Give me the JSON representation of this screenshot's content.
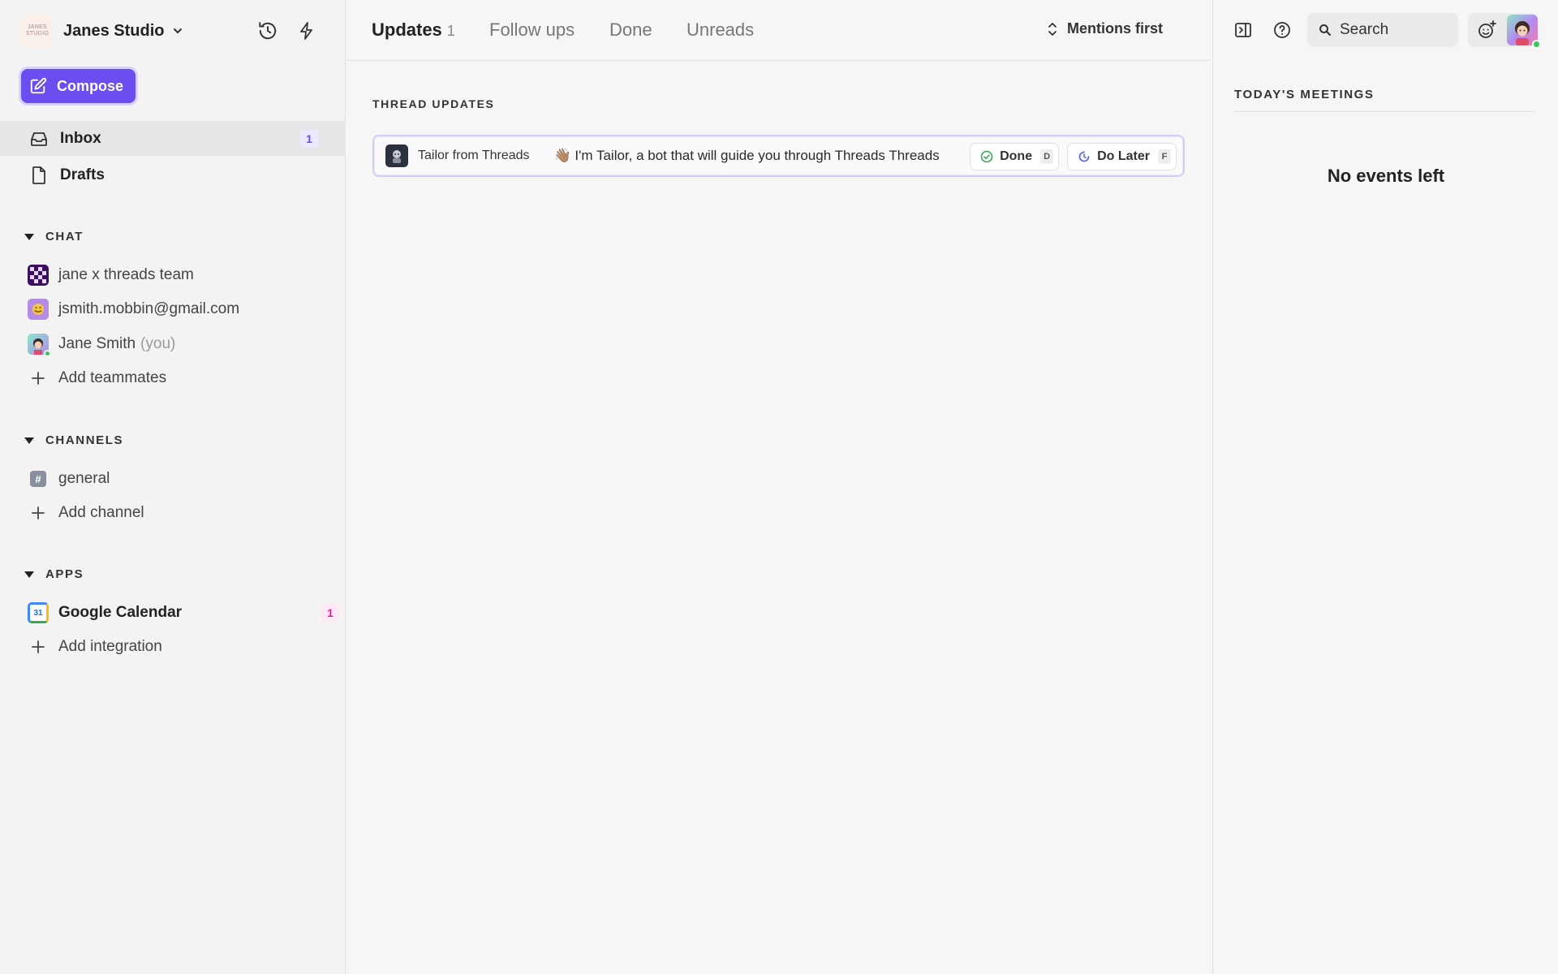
{
  "workspace": {
    "name": "Janes Studio",
    "logo_text": "JANES STUDIO"
  },
  "compose": {
    "label": "Compose"
  },
  "nav": [
    {
      "label": "Inbox",
      "badge": "1"
    },
    {
      "label": "Drafts"
    }
  ],
  "chat": {
    "header": "CHAT",
    "items": [
      {
        "label": "jane x threads team"
      },
      {
        "label": "jsmith.mobbin@gmail.com"
      },
      {
        "label": "Jane Smith",
        "suffix": "(you)"
      }
    ],
    "add_label": "Add teammates"
  },
  "channels": {
    "header": "CHANNELS",
    "items": [
      {
        "label": "general"
      }
    ],
    "add_label": "Add channel"
  },
  "apps": {
    "header": "APPS",
    "items": [
      {
        "label": "Google Calendar",
        "badge": "1",
        "icon_text": "31"
      }
    ],
    "add_label": "Add integration"
  },
  "tabs": [
    {
      "label": "Updates",
      "count": "1"
    },
    {
      "label": "Follow ups"
    },
    {
      "label": "Done"
    },
    {
      "label": "Unreads"
    }
  ],
  "sort": {
    "label": "Mentions first"
  },
  "thread_updates": {
    "title": "THREAD UPDATES",
    "items": [
      {
        "from": "Tailor from Threads",
        "message": "👋🏽 I'm Tailor, a bot that will guide you through Threads Threads",
        "done_label": "Done",
        "done_key": "D",
        "later_label": "Do Later",
        "later_key": "F"
      }
    ]
  },
  "search": {
    "placeholder": "Search"
  },
  "meetings": {
    "title": "TODAY'S MEETINGS",
    "empty": "No events left"
  },
  "colors": {
    "accent": "#6b4df0",
    "badge_pink": "#d8249a",
    "online": "#34c759"
  }
}
